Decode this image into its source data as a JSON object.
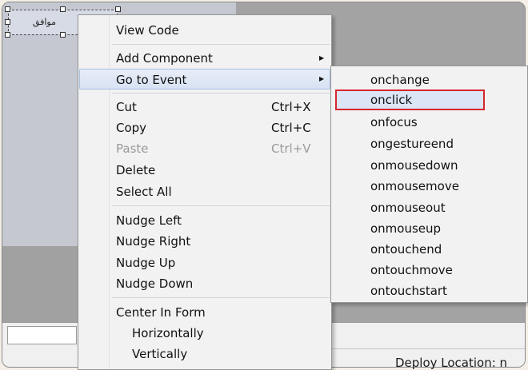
{
  "designer": {
    "button_label": "موافق"
  },
  "context_menu": {
    "items": [
      {
        "label": "View Code",
        "shortcut": "",
        "submenu": false,
        "disabled": false
      },
      {
        "label": "Add Component",
        "shortcut": "",
        "submenu": true,
        "disabled": false
      },
      {
        "label": "Go to Event",
        "shortcut": "",
        "submenu": true,
        "disabled": false,
        "hover": true
      },
      {
        "label": "Cut",
        "shortcut": "Ctrl+X",
        "submenu": false,
        "disabled": false
      },
      {
        "label": "Copy",
        "shortcut": "Ctrl+C",
        "submenu": false,
        "disabled": false
      },
      {
        "label": "Paste",
        "shortcut": "Ctrl+V",
        "submenu": false,
        "disabled": true
      },
      {
        "label": "Delete",
        "shortcut": "",
        "submenu": false,
        "disabled": false
      },
      {
        "label": "Select All",
        "shortcut": "",
        "submenu": false,
        "disabled": false
      },
      {
        "label": "Nudge Left",
        "shortcut": "",
        "submenu": false,
        "disabled": false
      },
      {
        "label": "Nudge Right",
        "shortcut": "",
        "submenu": false,
        "disabled": false
      },
      {
        "label": "Nudge Up",
        "shortcut": "",
        "submenu": false,
        "disabled": false
      },
      {
        "label": "Nudge Down",
        "shortcut": "",
        "submenu": false,
        "disabled": false
      },
      {
        "label": "Center In Form",
        "shortcut": "",
        "submenu": false,
        "disabled": false
      },
      {
        "label": "Horizontally",
        "shortcut": "",
        "submenu": false,
        "disabled": false
      },
      {
        "label": "Vertically",
        "shortcut": "",
        "submenu": false,
        "disabled": false
      }
    ],
    "submenu_arrow_icon": "triangle-right-icon"
  },
  "event_submenu": {
    "items": [
      {
        "label": "onchange"
      },
      {
        "label": "onclick",
        "highlighted": true
      },
      {
        "label": "onfocus"
      },
      {
        "label": "ongestureend"
      },
      {
        "label": "onmousedown"
      },
      {
        "label": "onmousemove"
      },
      {
        "label": "onmouseout"
      },
      {
        "label": "onmouseup"
      },
      {
        "label": "ontouchend"
      },
      {
        "label": "ontouchmove"
      },
      {
        "label": "ontouchstart"
      }
    ],
    "highlight_color": "#d8262d"
  },
  "status": {
    "deploy_location_label": "Deploy Location: n"
  }
}
